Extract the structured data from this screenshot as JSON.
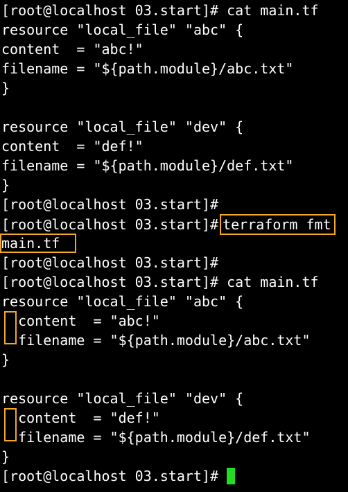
{
  "terminal": {
    "lines": [
      "[root@localhost 03.start]# cat main.tf",
      "resource \"local_file\" \"abc\" {",
      "content  = \"abc!\"",
      "filename = \"${path.module}/abc.txt\"",
      "}",
      "",
      "resource \"local_file\" \"dev\" {",
      "content  = \"def!\"",
      "filename = \"${path.module}/def.txt\"",
      "}",
      "[root@localhost 03.start]#",
      "[root@localhost 03.start]#",
      "main.tf",
      "[root@localhost 03.start]#",
      "[root@localhost 03.start]# cat main.tf",
      "resource \"local_file\" \"abc\" {",
      "  content  = \"abc!\"",
      "  filename = \"${path.module}/abc.txt\"",
      "}",
      "",
      "resource \"local_file\" \"dev\" {",
      "  content  = \"def!\"",
      "  filename = \"${path.module}/def.txt\"",
      "}",
      "[root@localhost 03.start]#"
    ],
    "highlighted_command": "terraform fmt",
    "highlight_color": "#f5a623",
    "cursor_color": "#22dd22",
    "background_color": "#000000",
    "text_color": "#ffffff"
  }
}
